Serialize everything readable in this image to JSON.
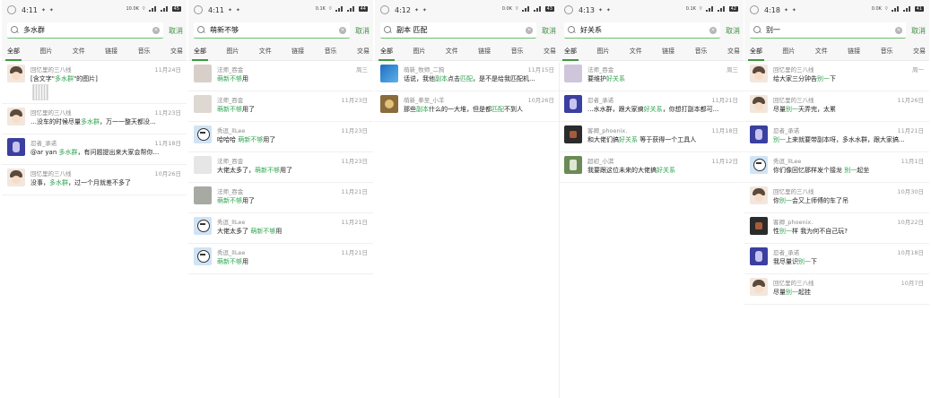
{
  "tabs": [
    "全部",
    "图片",
    "文件",
    "链接",
    "音乐",
    "交易"
  ],
  "cancel_label": "取消",
  "screens": [
    {
      "time": "4:11",
      "net": "10.0K",
      "battery": "45",
      "query": "多水群",
      "rows": [
        {
          "name": "回忆里的三八线",
          "date": "11月24日",
          "parts": [
            "[含文字\"",
            "多水群",
            "\"的图片]"
          ],
          "avatar": "face",
          "tall": true
        },
        {
          "name": "回忆里的三八线",
          "date": "11月23日",
          "parts": [
            "…没车的时候尽量",
            "多水群",
            "，万一一整天都没..."
          ],
          "avatar": "face"
        },
        {
          "name": "忍者_承诺",
          "date": "11月18日",
          "parts": [
            "@ar yan ",
            "多水群",
            "，有问题提出来大家会帮你..."
          ],
          "avatar": "purple"
        },
        {
          "name": "回忆里的三八线",
          "date": "10月26日",
          "parts": [
            "没事，",
            "多水群",
            "，过一个月就差不多了"
          ],
          "avatar": "face"
        }
      ]
    },
    {
      "time": "4:11",
      "net": "0.1K",
      "battery": "44",
      "query": "萌新不够",
      "rows": [
        {
          "name": "法师_吞金",
          "date": "周三",
          "parts": [
            "",
            "萌新不够",
            "用"
          ],
          "avatar": "gray1"
        },
        {
          "name": "法师_吞金",
          "date": "11月23日",
          "parts": [
            "",
            "萌新不够",
            "用了"
          ],
          "avatar": "gray2"
        },
        {
          "name": "秀逗_llLee",
          "date": "11月23日",
          "parts": [
            "哈哈哈 ",
            "萌新不够",
            "用了"
          ],
          "avatar": "cartoon"
        },
        {
          "name": "法师_吞金",
          "date": "11月23日",
          "parts": [
            "大佬太多了，",
            "萌新不够",
            "用了"
          ],
          "avatar": "gray3"
        },
        {
          "name": "法师_吞金",
          "date": "11月21日",
          "parts": [
            "",
            "萌新不够",
            "用了"
          ],
          "avatar": "gray4"
        },
        {
          "name": "秀逗_llLee",
          "date": "11月21日",
          "parts": [
            "大佬太多了 ",
            "萌新不够",
            "用"
          ],
          "avatar": "cartoon"
        },
        {
          "name": "秀逗_llLee",
          "date": "11月21日",
          "parts": [
            "",
            "萌新不够",
            "用"
          ],
          "avatar": "cartoon"
        }
      ]
    },
    {
      "time": "4:12",
      "net": "0.0K",
      "battery": "43",
      "query": "副本 匹配",
      "rows": [
        {
          "name": "萌新_牧师_二狗",
          "date": "11月15日",
          "parts": [
            "话说，我他",
            "副本",
            "点击",
            "匹配",
            "，是不是给我匹配机..."
          ],
          "avatar": "blue"
        },
        {
          "name": "萌新_拳至_小羊",
          "date": "10月26日",
          "parts": [
            "那些",
            "副本",
            "什么的一大堆，但是都",
            "匹配",
            "不到人"
          ],
          "avatar": "lion"
        }
      ]
    },
    {
      "time": "4:13",
      "net": "0.1K",
      "battery": "42",
      "query": "好关系",
      "rows": [
        {
          "name": "法师_吞金",
          "date": "周三",
          "parts": [
            "要维护",
            "好关系",
            ""
          ],
          "avatar": "lavender"
        },
        {
          "name": "忍者_承诺",
          "date": "11月21日",
          "parts": [
            "...水水群，跟大家搞",
            "好关系",
            "，你想打副本都可..."
          ],
          "avatar": "purple"
        },
        {
          "name": "客卿_phoenix.",
          "date": "11月18日",
          "parts": [
            "和大佬们搞",
            "好关系",
            " 等于获得一个工具人"
          ],
          "avatar": "dark"
        },
        {
          "name": "超初_小淇",
          "date": "11月12日",
          "parts": [
            "我要跟这位未来的大佬搞",
            "好关系",
            ""
          ],
          "avatar": "green"
        }
      ]
    },
    {
      "time": "4:18",
      "net": "0.0K",
      "battery": "41",
      "query": "别一",
      "rows": [
        {
          "name": "回忆里的三八线",
          "date": "周一",
          "parts": [
            "给大家三分钟告",
            "别一",
            "下"
          ],
          "avatar": "face"
        },
        {
          "name": "回忆里的三八线",
          "date": "11月26日",
          "parts": [
            "尽量",
            "别一",
            "天弄完，太累"
          ],
          "avatar": "face"
        },
        {
          "name": "忍者_承诺",
          "date": "11月21日",
          "parts": [
            "",
            "别一",
            "上来就要带副本呀，多水水群，跟大家搞..."
          ],
          "avatar": "purple"
        },
        {
          "name": "秀逗_llLee",
          "date": "11月1日",
          "parts": [
            "你们像回忆那样发个接龙 ",
            "别一",
            "起坐"
          ],
          "avatar": "cartoon"
        },
        {
          "name": "回忆里的三八线",
          "date": "10月30日",
          "parts": [
            "你",
            "别一",
            "会又上师傅的车了吊"
          ],
          "avatar": "face"
        },
        {
          "name": "客卿_phoenix.",
          "date": "10月22日",
          "parts": [
            "性",
            "别一",
            "样 我为何不自己玩?"
          ],
          "avatar": "dark"
        },
        {
          "name": "忍者_承诺",
          "date": "10月18日",
          "parts": [
            "我尽量识",
            "别一",
            "下"
          ],
          "avatar": "purple"
        },
        {
          "name": "回忆里的三八线",
          "date": "10月7日",
          "parts": [
            "尽量",
            "别一",
            "起挂"
          ],
          "avatar": "face"
        }
      ]
    }
  ]
}
